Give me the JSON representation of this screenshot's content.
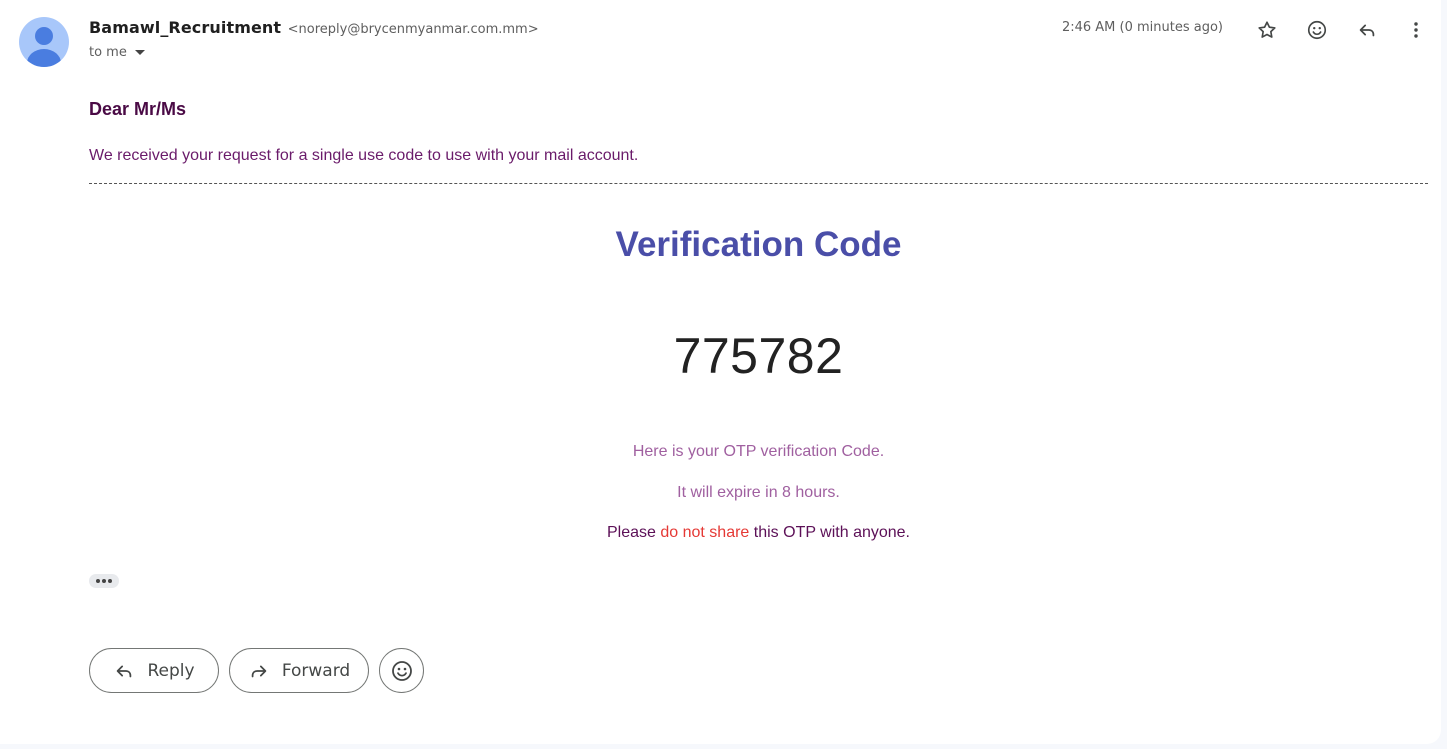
{
  "header": {
    "sender_name": "Bamawl_Recruitment",
    "sender_email": "<noreply@brycenmyanmar.com.mm>",
    "recipient": "to me",
    "timestamp": "2:46 AM (0 minutes ago)",
    "icons": [
      "star-icon",
      "emoji-react-icon",
      "reply-icon",
      "more-vert-icon"
    ]
  },
  "message": {
    "greeting": "Dear Mr/Ms",
    "intro": "We received your request for a single use code to use with your mail account.",
    "title": "Verification Code",
    "code": "775782",
    "info_line_1": "Here is your OTP verification Code.",
    "info_line_2": "It will expire in 8 hours.",
    "warning_prefix": "Please ",
    "warning_highlight": "do not share",
    "warning_suffix": " this OTP with anyone."
  },
  "actions": {
    "reply_label": "Reply",
    "forward_label": "Forward"
  },
  "colors": {
    "avatar_bg": "#a8c7fa",
    "avatar_fg": "#4a7de0",
    "title": "#4a4ea8",
    "highlight": "#e53935"
  }
}
